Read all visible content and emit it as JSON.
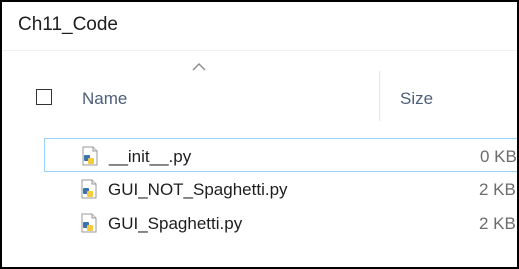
{
  "breadcrumb": {
    "folder": "Ch11_Code"
  },
  "columns": {
    "name_label": "Name",
    "size_label": "Size",
    "sort_icon": "chevron-up-icon",
    "sort_direction": "ascending"
  },
  "files": [
    {
      "name": "__init__.py",
      "size": "0 KB",
      "icon": "python-file-icon",
      "focused": true
    },
    {
      "name": "GUI_NOT_Spaghetti.py",
      "size": "2 KB",
      "icon": "python-file-icon",
      "focused": false
    },
    {
      "name": "GUI_Spaghetti.py",
      "size": "2 KB",
      "icon": "python-file-icon",
      "focused": false
    }
  ],
  "colors": {
    "header_text": "#4c607a",
    "focus_border": "#99d1ff",
    "python_blue": "#3a73b0",
    "python_yellow": "#f7cc3c"
  }
}
